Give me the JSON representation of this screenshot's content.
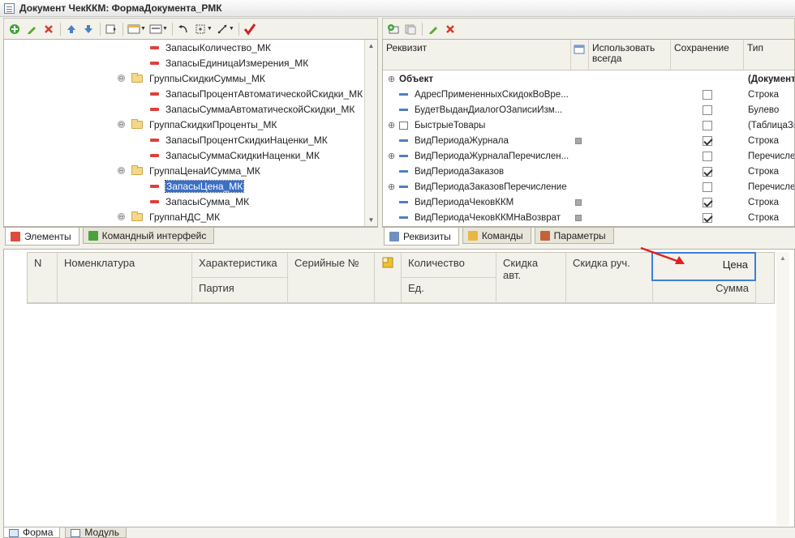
{
  "window": {
    "title": "Документ ЧекККМ: ФормаДокумента_РМК"
  },
  "left_tree": {
    "items": [
      {
        "label": "ЗапасыКоличество_МК",
        "kind": "leaf"
      },
      {
        "label": "ЗапасыЕдиницаИзмерения_МК",
        "kind": "leaf"
      },
      {
        "label": "ГруппыСкидкиСуммы_МК",
        "kind": "group"
      },
      {
        "label": "ЗапасыПроцентАвтоматическойСкидки_МК",
        "kind": "leaf"
      },
      {
        "label": "ЗапасыСуммаАвтоматическойСкидки_МК",
        "kind": "leaf"
      },
      {
        "label": "ГруппаСкидкиПроценты_МК",
        "kind": "group"
      },
      {
        "label": "ЗапасыПроцентСкидкиНаценки_МК",
        "kind": "leaf"
      },
      {
        "label": "ЗапасыСуммаСкидкиНаценки_МК",
        "kind": "leaf"
      },
      {
        "label": "ГруппаЦенаИСумма_МК",
        "kind": "group"
      },
      {
        "label": "ЗапасыЦена_МК",
        "kind": "leaf",
        "selected": true
      },
      {
        "label": "ЗапасыСумма_МК",
        "kind": "leaf"
      },
      {
        "label": "ГруппаНДС_МК",
        "kind": "group"
      }
    ],
    "collapse_glyph": "⊖"
  },
  "left_tabs": [
    {
      "label": "Элементы",
      "active": true
    },
    {
      "label": "Командный интерфейс",
      "active": false
    }
  ],
  "right_grid": {
    "headers": {
      "rekvizit": "Реквизит",
      "always_line1": "Использовать",
      "always_line2": "всегда",
      "save": "Сохранение",
      "type": "Тип"
    },
    "rows": [
      {
        "name": "Объект",
        "bold": true,
        "expand": "⊕",
        "save": null,
        "type": "(Документ"
      },
      {
        "name": "АдресПримененныхСкидокВоВре...",
        "expand": "",
        "save": false,
        "type": "Строка"
      },
      {
        "name": "БудетВыданДиалогОЗаписиИзм...",
        "expand": "",
        "save": false,
        "type": "Булево"
      },
      {
        "name": "БыстрыеТовары",
        "expand": "⊕",
        "table": true,
        "save": false,
        "type": "(ТаблицаЗн"
      },
      {
        "name": "ВидПериодаЖурнала",
        "expand": "",
        "always": true,
        "save": true,
        "type": "Строка"
      },
      {
        "name": "ВидПериодаЖурналаПеречислен...",
        "expand": "⊕",
        "save": false,
        "type": "Перечислен"
      },
      {
        "name": "ВидПериодаЗаказов",
        "expand": "",
        "save": true,
        "type": "Строка"
      },
      {
        "name": "ВидПериодаЗаказовПеречисление",
        "expand": "⊕",
        "save": false,
        "type": "Перечислен"
      },
      {
        "name": "ВидПериодаЧековККМ",
        "expand": "",
        "always": true,
        "save": true,
        "type": "Строка"
      },
      {
        "name": "ВидПериодаЧековККМНаВозврат",
        "expand": "",
        "always": true,
        "save": true,
        "type": "Строка"
      }
    ]
  },
  "right_tabs": [
    {
      "label": "Реквизиты",
      "active": true
    },
    {
      "label": "Команды",
      "active": false
    },
    {
      "label": "Параметры",
      "active": false
    }
  ],
  "form_table": {
    "columns": {
      "n": "N",
      "nomenclature": "Номенклатура",
      "characteristic": "Характеристика",
      "batch": "Партия",
      "serial": "Серийные №",
      "quantity": "Количество",
      "unit": "Ед.",
      "discount_auto_line1": "Скидка",
      "discount_auto_line2": "авт.",
      "discount_manual": "Скидка руч.",
      "price": "Цена",
      "sum": "Сумма"
    }
  },
  "bottom_tabs": [
    {
      "label": "Форма",
      "active": true
    },
    {
      "label": "Модуль",
      "active": false
    }
  ],
  "colors": {
    "accent": "#3d7fd6",
    "arrow": "#e02020",
    "check": "#d02020"
  },
  "icons": {
    "add": "add-icon",
    "edit": "pencil-icon",
    "delete": "delete-icon",
    "up": "arrow-up-icon",
    "down": "arrow-down-icon",
    "check": "checkmark-icon"
  }
}
